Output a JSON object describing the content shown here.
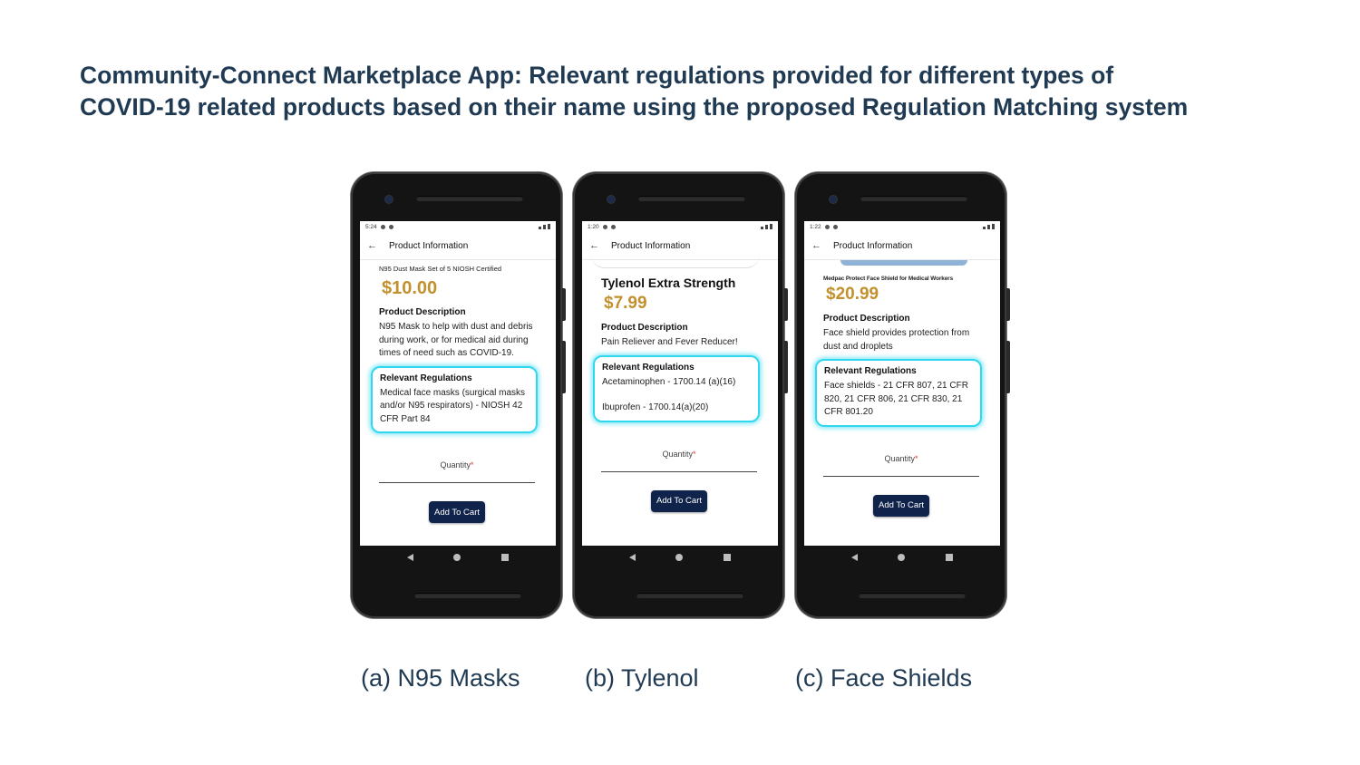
{
  "slide": {
    "title_line1": "Community-Connect Marketplace App: Relevant regulations provided for different types of",
    "title_line2": "COVID-19 related products based on their name using the proposed Regulation Matching system"
  },
  "phones": [
    {
      "status_time": "5:24",
      "app_bar_title": "Product Information",
      "product_name": "N95 Dust Mask Set of 5 NIOSH Certified",
      "price": "$10.00",
      "desc_heading": "Product Description",
      "description": "N95 Mask to help with dust and debris during work, or for medical aid during times of need such as COVID-19.",
      "reg_heading": "Relevant Regulations",
      "regulations": [
        "Medical face masks (surgical masks and/or N95 respirators) - NIOSH 42 CFR Part 84"
      ],
      "quantity_label": "Quantity",
      "required_mark": "*",
      "cart_label": "Add To Cart",
      "caption": "(a) N95 Masks"
    },
    {
      "status_time": "1:20",
      "app_bar_title": "Product Information",
      "product_name": "Tylenol Extra Strength",
      "price": "$7.99",
      "desc_heading": "Product Description",
      "description": "Pain Reliever and Fever Reducer!",
      "reg_heading": "Relevant Regulations",
      "regulations": [
        "Acetaminophen - 1700.14 (a)(16)",
        "Ibuprofen - 1700.14(a)(20)"
      ],
      "quantity_label": "Quantity",
      "required_mark": "*",
      "cart_label": "Add To Cart",
      "caption": "(b) Tylenol"
    },
    {
      "status_time": "1:22",
      "app_bar_title": "Product Information",
      "product_name": "Medpac Protect Face Shield for Medical Workers",
      "price": "$20.99",
      "desc_heading": "Product Description",
      "description": "Face shield provides protection from dust and droplets",
      "reg_heading": "Relevant Regulations",
      "regulations": [
        "Face shields - 21 CFR 807, 21 CFR 820, 21 CFR 806, 21 CFR 830, 21 CFR 801.20"
      ],
      "quantity_label": "Quantity",
      "required_mark": "*",
      "cart_label": "Add To Cart",
      "caption": "(c) Face Shields"
    }
  ],
  "colors": {
    "title": "#1f3a52",
    "price": "#c2912e",
    "highlight": "#2fd7ef",
    "button": "#10234a"
  }
}
